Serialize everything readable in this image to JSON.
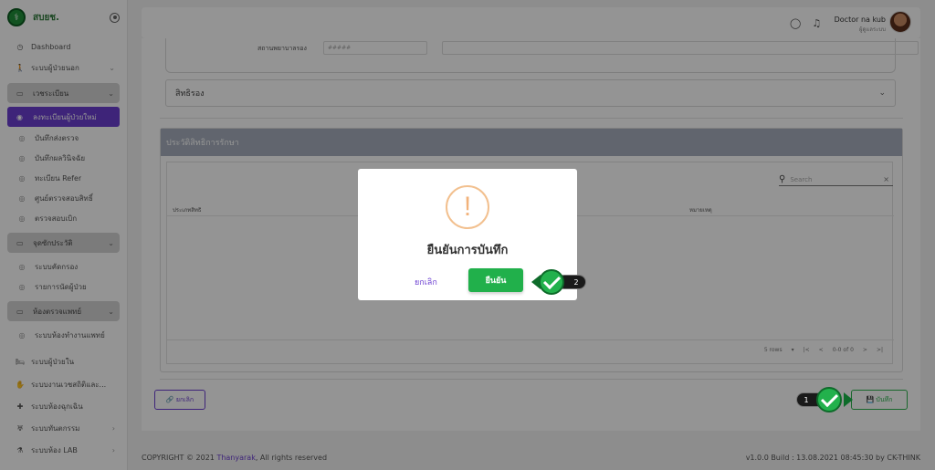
{
  "brand": {
    "name": "สบยช."
  },
  "sidebar": {
    "dashboard": "Dashboard",
    "outpatient": "ระบบผู้ป่วยนอก",
    "registration_group": "เวชระเบียน",
    "active_item": "ลงทะเบียนผู้ป่วยใหม่",
    "reg_items": [
      "บันทึกส่งตรวจ",
      "บันทึกผลวินิจฉัย",
      "ทะเบียน Refer",
      "ศูนย์ตรวจสอบสิทธิ์",
      "ตรวจสอบเบิก"
    ],
    "screening_group": "จุดซักประวัติ",
    "screening_items": [
      "ระบบคัดกรอง",
      "รายการนัดผู้ป่วย"
    ],
    "doctor_group": "ห้องตรวจแพทย์",
    "doctor_items": [
      "ระบบห้องทำงานแพทย์"
    ],
    "modules": [
      "ระบบผู้ป่วยใน",
      "ระบบงานเวชสถิติและ...",
      "ระบบห้องฉุกเฉิน",
      "ระบบทันตกรรม",
      "ระบบห้อง LAB"
    ]
  },
  "topbar": {
    "user_name": "Doctor na kub",
    "user_role": "ผู้ดูแลระบบ"
  },
  "form": {
    "status_label": "สถานพยาบาลรอง",
    "status_placeholder": "#####",
    "rights_label": "สิทธิรอง"
  },
  "history": {
    "title": "ประวัติสิทธิการรักษา",
    "search_placeholder": "Search",
    "col_type": "ประเภทสิทธิ",
    "col_note": "หมายเหตุ",
    "rows_per_page": "5 rows",
    "page_info": "0-0 of 0",
    "pager_first": "|<",
    "pager_prev": "<",
    "pager_next": ">",
    "pager_last": ">|"
  },
  "buttons": {
    "reset": "ยกเลิก",
    "save": "บันทึก"
  },
  "footer": {
    "copyright_prefix": "COPYRIGHT © 2021",
    "copyright_brand": "Thanyarak",
    "copyright_suffix": ", All rights reserved",
    "version": "v1.0.0 Build : 13.08.2021 08:45:30 by CK-THINK"
  },
  "modal": {
    "title": "ยืนยันการบันทึก",
    "cancel": "ยกเลิก",
    "confirm": "ยืนยัน"
  },
  "steps": {
    "step1": "1",
    "step2": "2"
  },
  "colors": {
    "accent": "#6c3fd1",
    "confirm": "#21b04b",
    "warning": "#f2c08f",
    "header": "#a7afbd"
  }
}
